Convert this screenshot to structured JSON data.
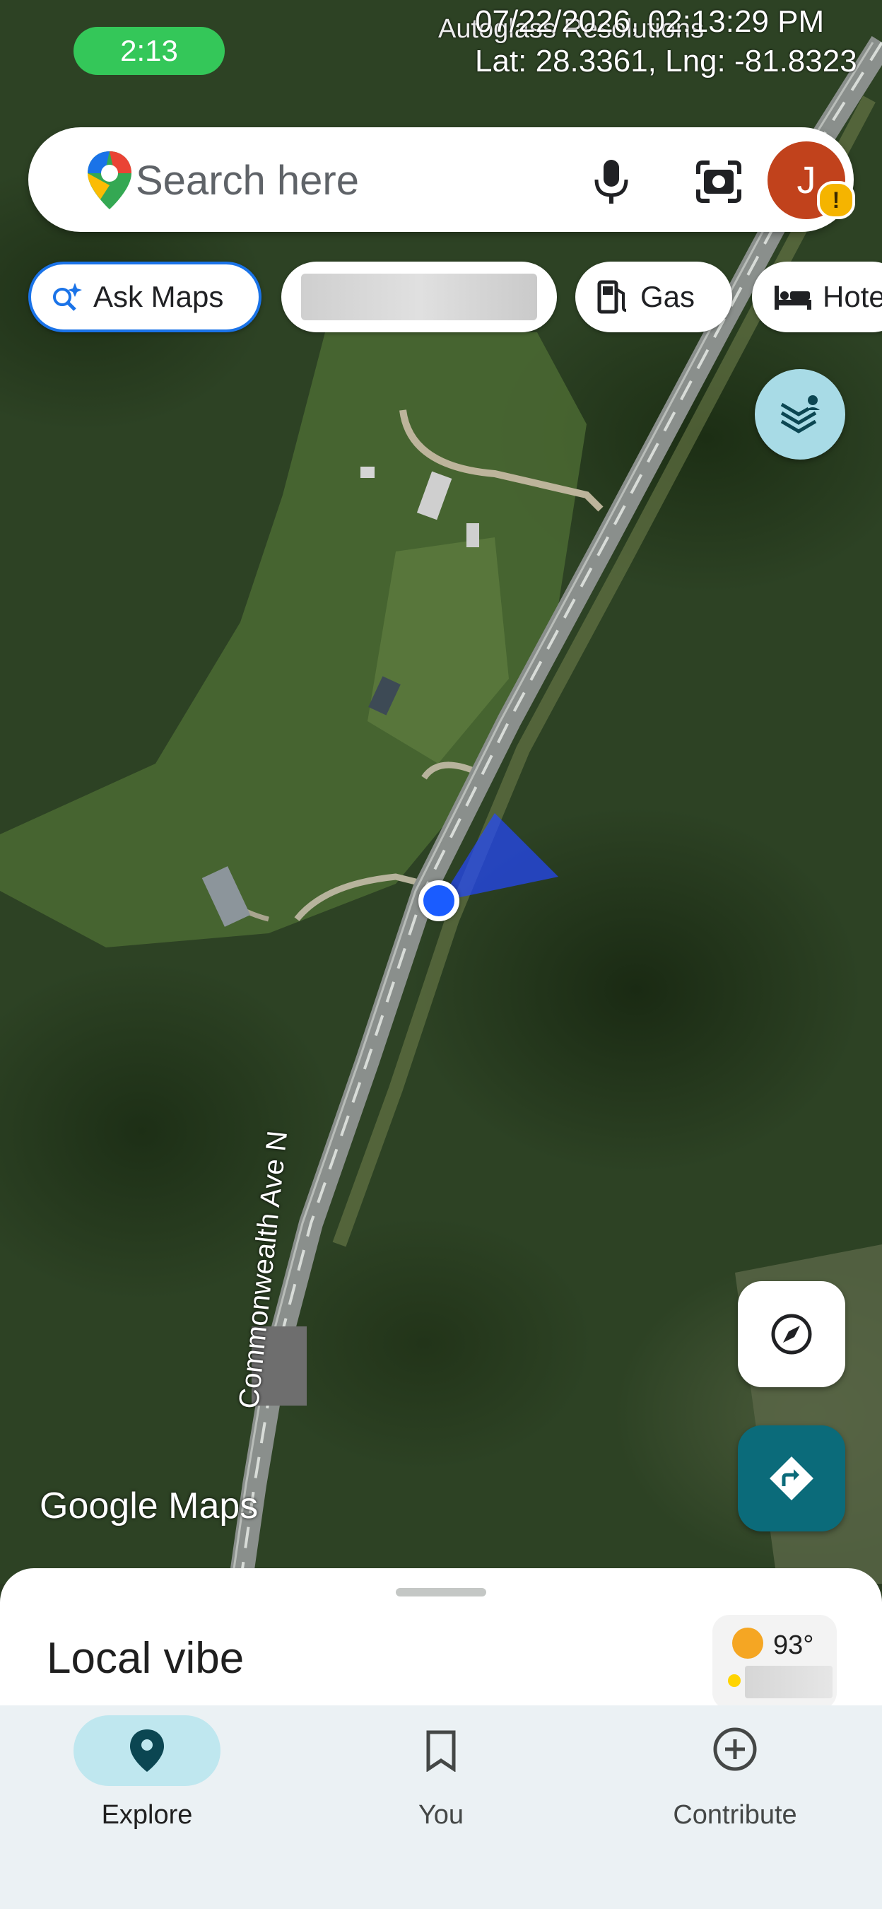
{
  "status_bar": {
    "time": "2:13"
  },
  "overlay": {
    "timestamp": "07/22/2026, 02:13:29 PM",
    "coords": "Lat: 28.3361, Lng: -81.8323",
    "place_label": "Autoglass Resolutions"
  },
  "search": {
    "placeholder": "Search here",
    "avatar_letter": "J"
  },
  "chips": [
    {
      "label": "Ask Maps",
      "icon": "sparkle-search-icon"
    },
    {
      "label": "",
      "icon": ""
    },
    {
      "label": "Gas",
      "icon": "gas-pump-icon"
    },
    {
      "label": "Hotels",
      "icon": "bed-icon"
    }
  ],
  "map": {
    "road_label": "Commonwealth Ave N",
    "brand": "Google Maps"
  },
  "sheet": {
    "title": "Local vibe",
    "temperature": "93°"
  },
  "nav": [
    {
      "label": "Explore",
      "icon": "pin-icon",
      "active": true
    },
    {
      "label": "You",
      "icon": "bookmark-icon",
      "active": false
    },
    {
      "label": "Contribute",
      "icon": "plus-circle-icon",
      "active": false
    }
  ],
  "colors": {
    "accent_teal": "#0b6b7a",
    "chip_active_border": "#1a73e8",
    "location_blue": "#1a5cff",
    "time_pill": "#34c759"
  }
}
